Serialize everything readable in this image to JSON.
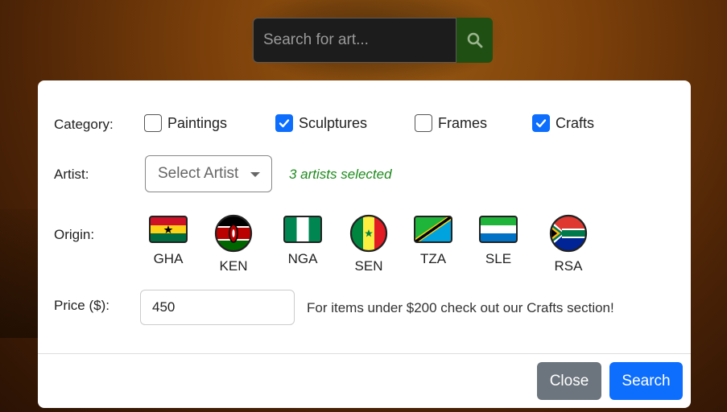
{
  "search": {
    "placeholder": "Search for art..."
  },
  "filters": {
    "category_label": "Category:",
    "categories": [
      {
        "label": "Paintings",
        "checked": false
      },
      {
        "label": "Sculptures",
        "checked": true
      },
      {
        "label": "Frames",
        "checked": false
      },
      {
        "label": "Crafts",
        "checked": true
      }
    ],
    "artist_label": "Artist:",
    "artist_select": "Select Artist",
    "artists_note": "3 artists selected",
    "origin_label": "Origin:",
    "origins": [
      "GHA",
      "KEN",
      "NGA",
      "SEN",
      "TZA",
      "SLE",
      "RSA"
    ],
    "price_label": "Price ($):",
    "price_value": "450",
    "price_note": "For items under $200 check out our Crafts section!"
  },
  "footer": {
    "close_label": "Close",
    "search_label": "Search"
  },
  "colors": {
    "primary": "#0d6efd",
    "secondary": "#6c757d",
    "note_green": "#1e8a1e",
    "search_btn": "#1f4f12"
  }
}
